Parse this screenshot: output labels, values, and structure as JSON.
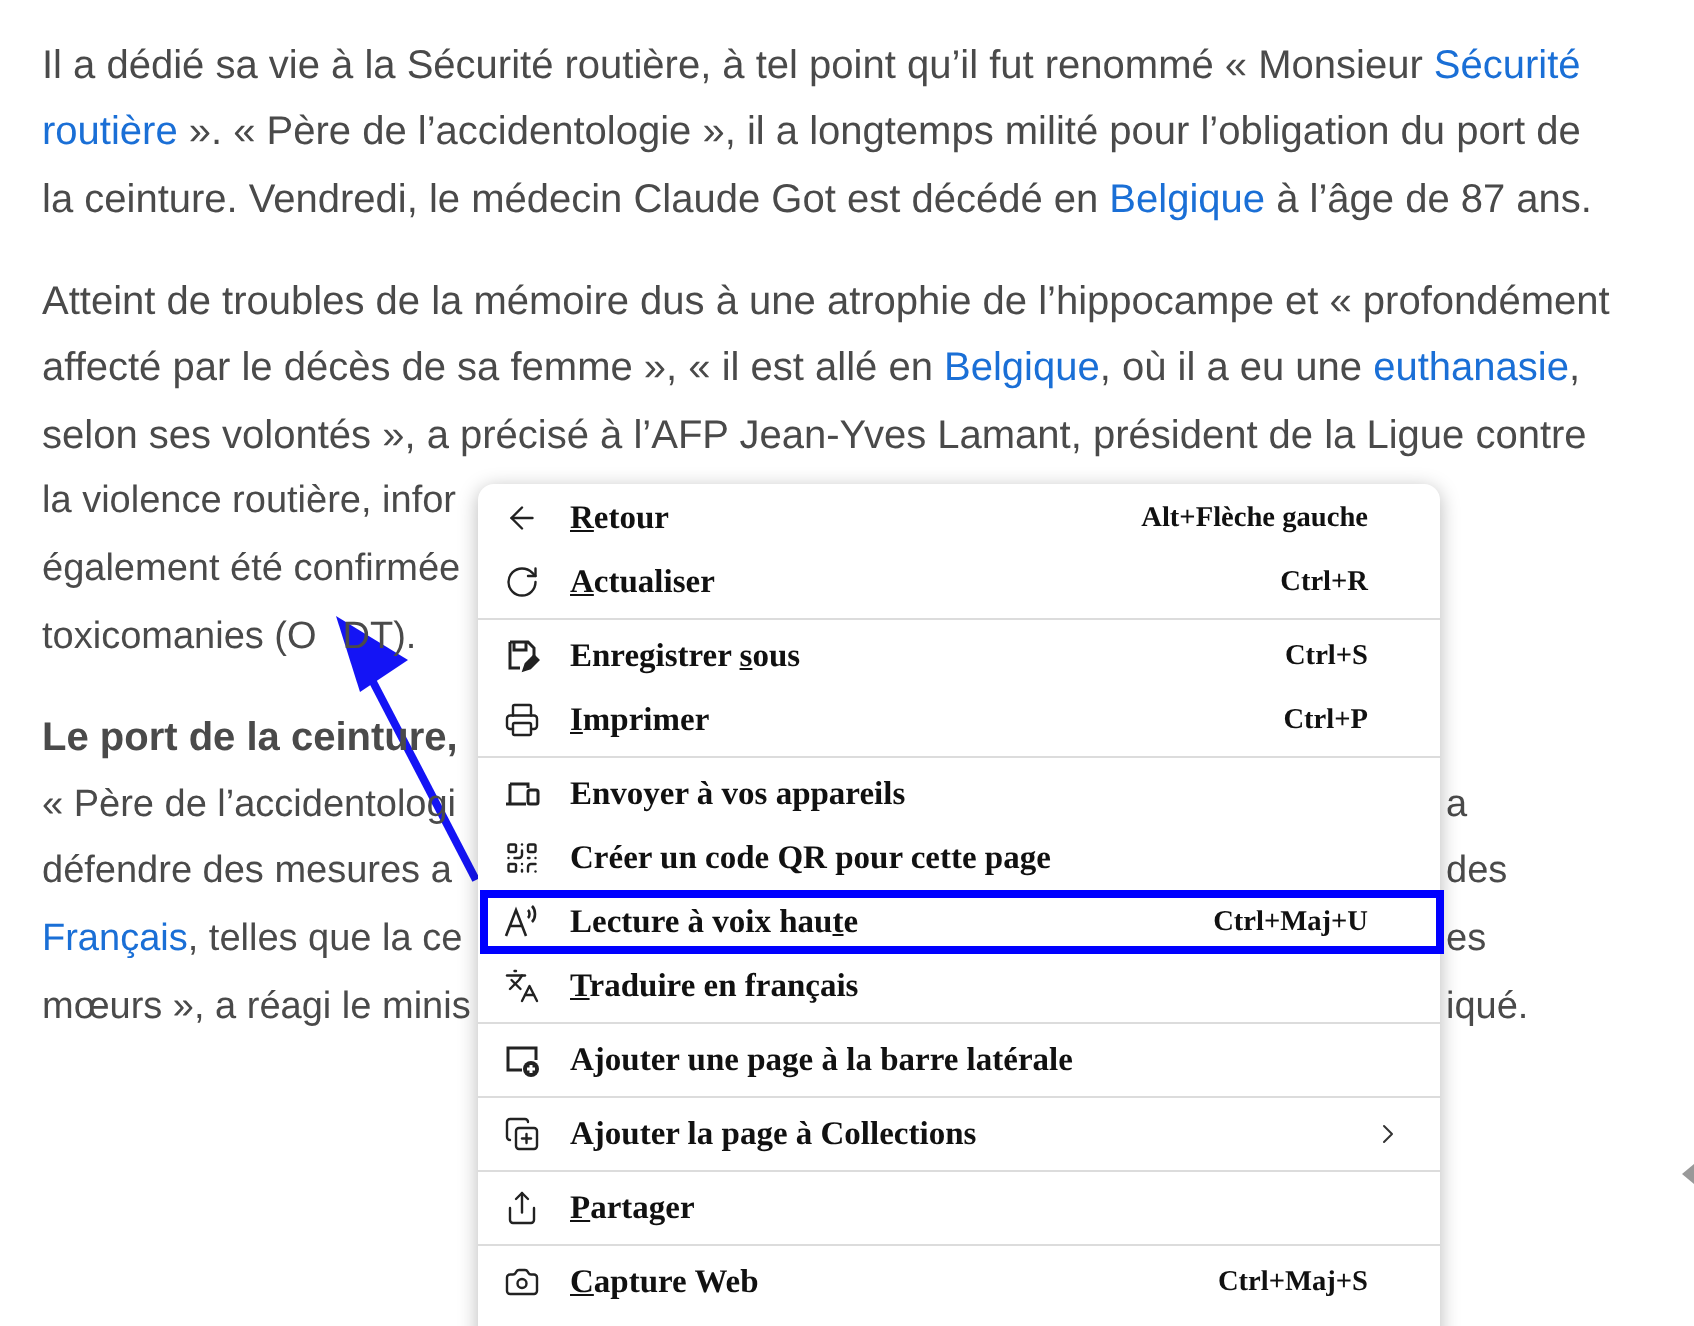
{
  "article": {
    "paragraphs": [
      {
        "lines": [
          {
            "segments": [
              {
                "text": "Il a dédié sa vie à la Sécurité routière, à tel point qu’il fut renommé « Monsieur ",
                "link": false
              },
              {
                "text": "Sécurité",
                "link": true
              }
            ]
          },
          {
            "segments": [
              {
                "text": "routière",
                "link": true
              },
              {
                "text": " ». « Père de l’accidentologie », il a longtemps milité pour l’obligation du port de",
                "link": false
              }
            ]
          },
          {
            "segments": [
              {
                "text": "la ceinture. Vendredi, le médecin Claude Got est décédé en ",
                "link": false
              },
              {
                "text": "Belgique",
                "link": true
              },
              {
                "text": " à l’âge de 87 ans.",
                "link": false
              }
            ]
          }
        ]
      },
      {
        "lines": [
          {
            "segments": [
              {
                "text": "Atteint de troubles de la mémoire dus à une atrophie de l’hippocampe et « profondément",
                "link": false
              }
            ]
          },
          {
            "segments": [
              {
                "text": "affecté par le décès de sa femme », « il est allé en ",
                "link": false
              },
              {
                "text": "Belgique",
                "link": true
              },
              {
                "text": ", où il a eu une ",
                "link": false
              },
              {
                "text": "euthanasie",
                "link": true
              },
              {
                "text": ",",
                "link": false
              }
            ]
          },
          {
            "segments": [
              {
                "text": "selon ses volontés », a précisé à l’AFP Jean-Yves Lamant, président de la Ligue contre",
                "link": false
              }
            ]
          },
          {
            "segments": [
              {
                "text": "la violence routière, infor",
                "link": false
              }
            ]
          },
          {
            "segments": [
              {
                "text": "également été confirmée",
                "link": false
              }
            ]
          },
          {
            "segments": [
              {
                "text": "toxicomanies (O",
                "link": false
              },
              {
                "text": "DT).",
                "link": false,
                "gap": true
              }
            ]
          }
        ]
      },
      {
        "lines": [
          {
            "bold": true,
            "segments": [
              {
                "text": "Le port de la ceinture,",
                "link": false
              }
            ]
          },
          {
            "segments": [
              {
                "text": "« Père de l’accidentologi",
                "link": false
              }
            ],
            "right": "a"
          },
          {
            "segments": [
              {
                "text": "défendre des mesures a",
                "link": false
              }
            ],
            "right": "des"
          },
          {
            "segments": [
              {
                "text": "Français",
                "link": true
              },
              {
                "text": ", telles que la ce",
                "link": false
              }
            ],
            "right": "es"
          },
          {
            "segments": [
              {
                "text": "mœurs », a réagi le minis",
                "link": false
              }
            ],
            "right": "iqué."
          }
        ]
      }
    ]
  },
  "context_menu": {
    "groups": [
      [
        {
          "accel": "R",
          "after": "etour",
          "shortcut": "Alt+Flèche gauche",
          "highlighted": false
        },
        {
          "accel": "A",
          "after": "ctualiser",
          "shortcut": "Ctrl+R",
          "highlighted": false
        }
      ],
      [
        {
          "before": "Enregistrer ",
          "accel": "s",
          "after": "ous",
          "shortcut": "Ctrl+S",
          "highlighted": false
        },
        {
          "accel": "I",
          "after": "mprimer",
          "shortcut": "Ctrl+P",
          "highlighted": false
        }
      ],
      [
        {
          "before": "Envoyer à vos appareils",
          "highlighted": false
        },
        {
          "before": "Créer un code QR pour cette page",
          "highlighted": false
        },
        {
          "before": "Lecture à voix hau",
          "accel": "t",
          "after": "e",
          "shortcut": "Ctrl+Maj+U",
          "highlighted": true
        },
        {
          "accel": "T",
          "after": "raduire en français",
          "highlighted": false
        }
      ],
      [
        {
          "before": "Ajouter une page à la barre latérale",
          "highlighted": false
        }
      ],
      [
        {
          "before": "Ajouter la page à Collections",
          "has_submenu": true,
          "highlighted": false
        }
      ],
      [
        {
          "accel": "P",
          "after": "artager",
          "highlighted": false
        }
      ],
      [
        {
          "accel": "C",
          "after": "apture Web",
          "shortcut": "Ctrl+Maj+S",
          "highlighted": false
        }
      ]
    ]
  }
}
